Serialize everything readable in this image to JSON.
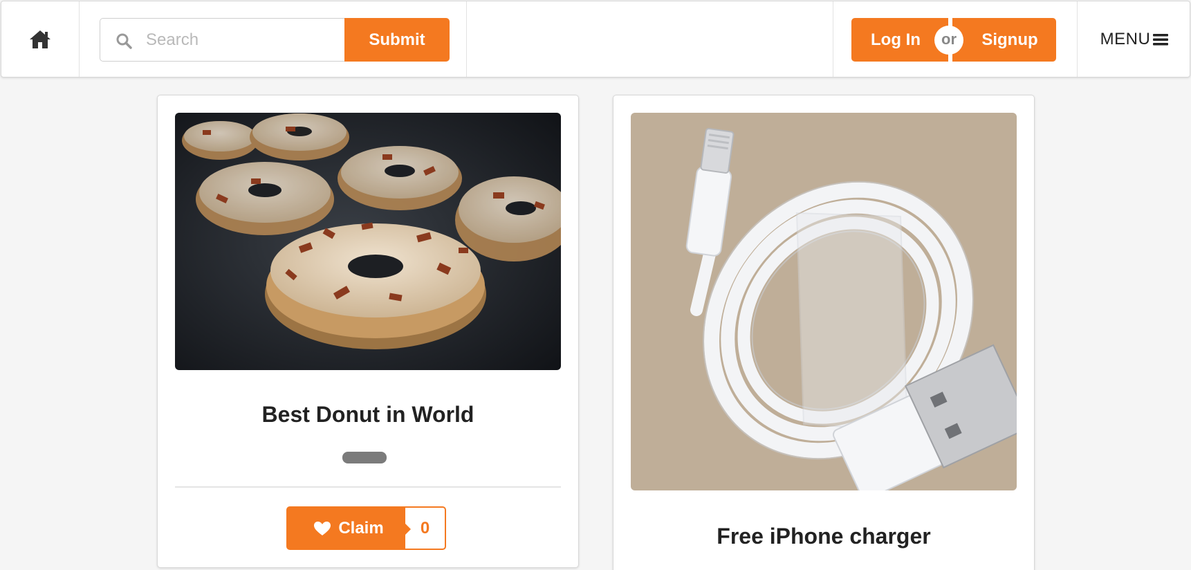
{
  "nav": {
    "home_icon": "home-icon",
    "search": {
      "icon": "search-icon",
      "placeholder": "Search",
      "value": ""
    },
    "submit_label": "Submit",
    "login_label": "Log In",
    "or_label": "or",
    "signup_label": "Signup",
    "menu_label": "MENU",
    "menu_icon": "hamburger-icon"
  },
  "cards": [
    {
      "image": "donut-photo",
      "title": "Best Donut in World",
      "claim_label": "Claim",
      "claim_icon": "heart-icon",
      "claim_count": "0"
    },
    {
      "image": "charger-photo",
      "title": "Free iPhone charger"
    }
  ],
  "colors": {
    "accent": "#f47920",
    "pill": "#7b7b7b",
    "text": "#222222"
  }
}
